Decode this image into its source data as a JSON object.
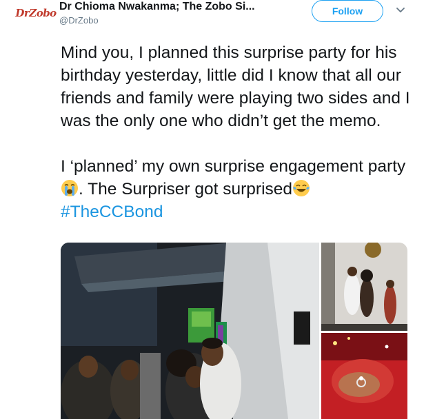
{
  "author": {
    "avatar_text": "DrZobo",
    "name": "Dr Chioma Nwakanma; The Zobo Si...",
    "handle": "@DrZobo"
  },
  "follow_label": "Follow",
  "tweet": {
    "paragraph1": "Mind you, I planned this surprise party for his birthday yesterday, little did I know that all our friends and family were playing two sides and I was the only one who didn’t get the memo.",
    "paragraph2_part1": "I ‘planned’ my own surprise engagement party",
    "paragraph2_part2": ". The Surpriser got surprised",
    "hashtag": "#TheCCBond",
    "emojis": [
      "loudly-crying-face",
      "face-with-tears-of-joy"
    ]
  },
  "media": {
    "photos": [
      "engagement-party-main",
      "engagement-party-couple-standing",
      "engagement-ring-closeup"
    ]
  },
  "colors": {
    "brand_blue": "#1da1f2",
    "hashtag_blue": "#1b95e0",
    "text": "#14171a",
    "secondary": "#657786",
    "avatar_red": "#c0392b"
  }
}
